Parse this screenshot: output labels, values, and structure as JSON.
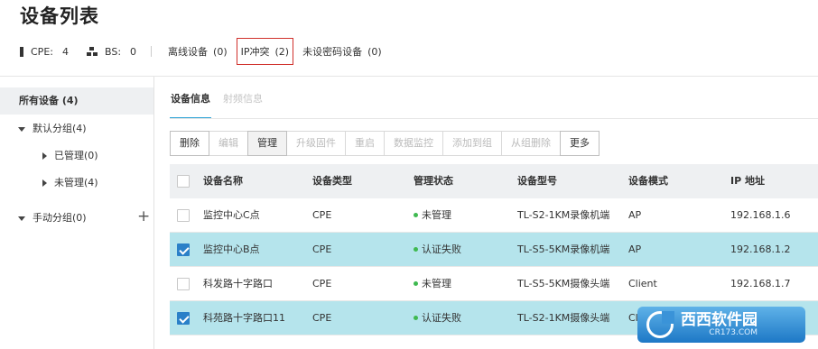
{
  "page_title": "设备列表",
  "stats": {
    "cpe": {
      "label": "CPE:",
      "value": "4"
    },
    "bs": {
      "label": "BS:",
      "value": "0"
    },
    "filters": [
      {
        "label": "离线设备",
        "count": "(0)",
        "active": false
      },
      {
        "label": "IP冲突",
        "count": "(2)",
        "active": true
      },
      {
        "label": "未设密码设备",
        "count": "(0)",
        "active": false
      }
    ]
  },
  "sidebar": {
    "all_devices": "所有设备 (4)",
    "default_group": "默认分组(4)",
    "managed": "已管理(0)",
    "unmanaged": "未管理(4)",
    "manual_group": "手动分组(0)"
  },
  "tabs": [
    {
      "label": "设备信息",
      "active": true
    },
    {
      "label": "射频信息",
      "active": false
    }
  ],
  "toolbar": {
    "delete": "删除",
    "edit": "编辑",
    "manage": "管理",
    "upgrade": "升级固件",
    "reboot": "重启",
    "monitor": "数据监控",
    "add_to_group": "添加到组",
    "remove_from_group": "从组删除",
    "more": "更多"
  },
  "table": {
    "columns": [
      "设备名称",
      "设备类型",
      "管理状态",
      "设备型号",
      "设备模式",
      "IP 地址"
    ],
    "rows": [
      {
        "name": "监控中心C点",
        "type": "CPE",
        "status": "未管理",
        "model": "TL-S2-1KM录像机端",
        "mode": "AP",
        "ip": "192.168.1.6",
        "checked": false
      },
      {
        "name": "监控中心B点",
        "type": "CPE",
        "status": "认证失败",
        "model": "TL-S5-5KM录像机端",
        "mode": "AP",
        "ip": "192.168.1.2",
        "checked": true
      },
      {
        "name": "科发路十字路口",
        "type": "CPE",
        "status": "未管理",
        "model": "TL-S5-5KM摄像头端",
        "mode": "Client",
        "ip": "192.168.1.7",
        "checked": false
      },
      {
        "name": "科苑路十字路口11",
        "type": "CPE",
        "status": "认证失败",
        "model": "TL-S2-1KM摄像头端",
        "mode": "Cli",
        "ip": "",
        "checked": true
      }
    ]
  },
  "watermark": {
    "text": "西西软件园",
    "sub": "CR173.COM"
  },
  "colors": {
    "accent": "#2aa2d6",
    "selected_row": "#b5e4ec",
    "conflict_border": "#d0302b",
    "status_dot": "#3fb950",
    "checkbox": "#2b80c8"
  }
}
